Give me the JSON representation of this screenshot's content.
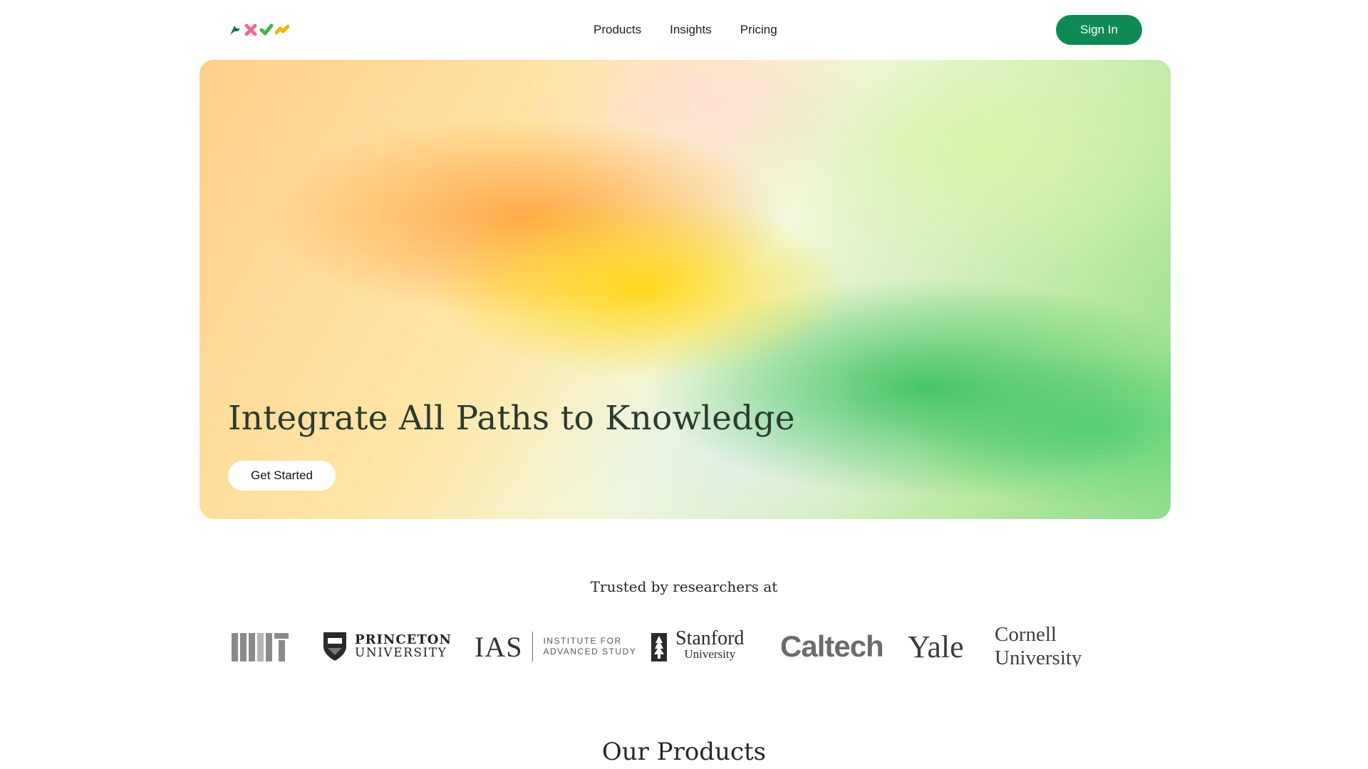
{
  "nav": {
    "logo_icons": [
      "green-arrow-icon",
      "pink-cross-icon",
      "green-check-icon",
      "yellow-zigzag-icon"
    ],
    "menu": [
      {
        "label": "Products"
      },
      {
        "label": "Insights"
      },
      {
        "label": "Pricing"
      }
    ],
    "sign_in_label": "Sign In"
  },
  "hero": {
    "title": "Integrate All Paths to Knowledge",
    "cta_label": "Get Started"
  },
  "trusted": {
    "heading": "Trusted by researchers at",
    "logos": {
      "princeton_line1": "PRINCETON",
      "princeton_line2": "UNIVERSITY",
      "ias_abbr": "IAS",
      "ias_line1": "INSTITUTE FOR",
      "ias_line2": "ADVANCED STUDY",
      "stanford_line1": "Stanford",
      "stanford_line2": "University",
      "caltech": "Caltech",
      "yale": "Yale",
      "cornell": "Cornell University"
    }
  },
  "products": {
    "heading": "Our Products"
  },
  "colors": {
    "brand_green": "#0f8a55",
    "text_dark": "#1f2a24"
  }
}
